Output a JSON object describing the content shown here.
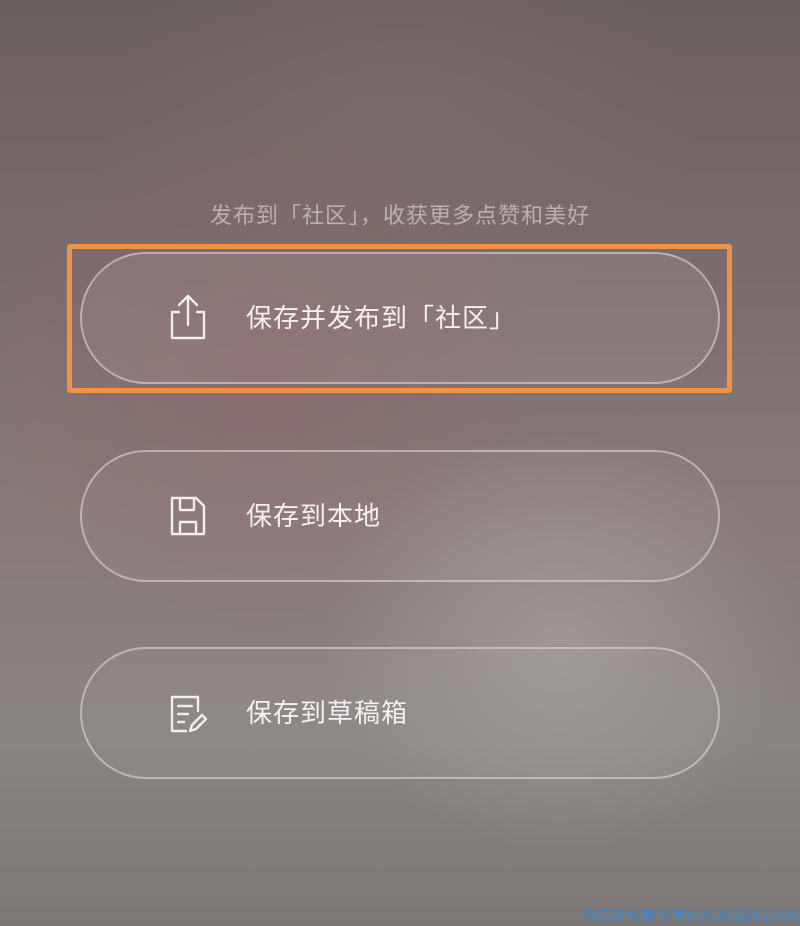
{
  "subtitle": "发布到「社区」，收获更多点赞和美好",
  "options": [
    {
      "label": "保存并发布到「社区」",
      "icon": "share-upload-icon"
    },
    {
      "label": "保存到本地",
      "icon": "floppy-save-icon"
    },
    {
      "label": "保存到草稿箱",
      "icon": "draft-edit-icon"
    }
  ],
  "highlight_color": "#f0914a",
  "watermark": "番茄联盟聚创营团队邀请码1688"
}
